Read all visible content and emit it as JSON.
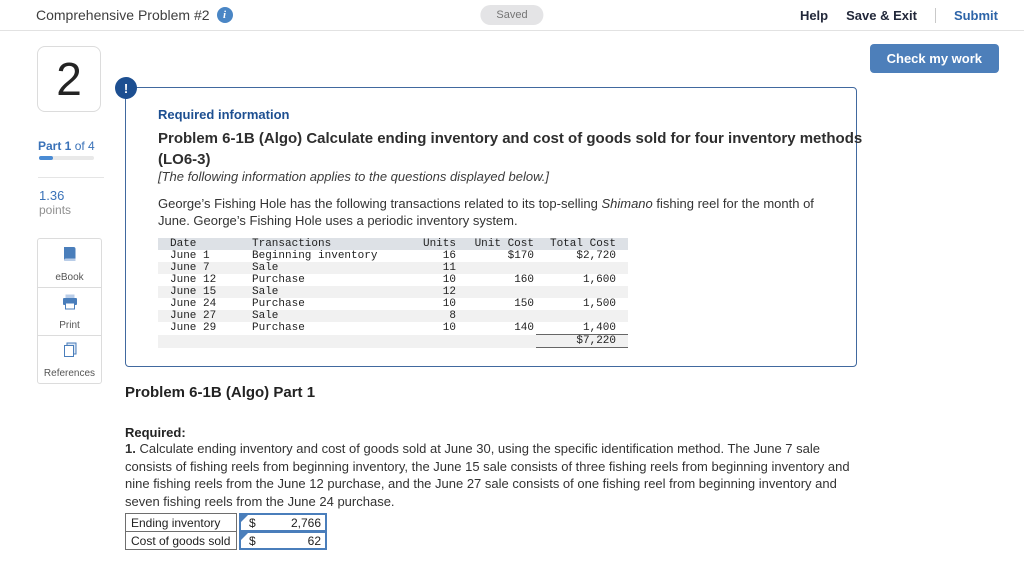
{
  "topbar": {
    "title": "Comprehensive Problem #2",
    "info_icon": "i",
    "saved_badge": "Saved",
    "help": "Help",
    "save_exit": "Save & Exit",
    "submit": "Submit"
  },
  "check_my_work": "Check my work",
  "sidebar": {
    "question_number": "2",
    "part_bold": "Part 1",
    "part_rest": " of 4",
    "progress_percent": 25,
    "points_value": "1.36",
    "points_label": "points",
    "tools": {
      "ebook": "eBook",
      "print": "Print",
      "references": "References"
    }
  },
  "info_box": {
    "alert": "!",
    "required_info": "Required information",
    "title": "Problem 6-1B (Algo) Calculate ending inventory and cost of goods sold for four inventory methods (LO6-3)",
    "subtitle": "[The following information applies to the questions displayed below.]",
    "para_before": "George’s Fishing Hole has the following transactions related to its top-selling ",
    "para_italic": "Shimano",
    "para_after": " fishing reel for the month of June. George’s Fishing Hole uses a periodic inventory system.",
    "table": {
      "headers": {
        "date": "Date",
        "transactions": "Transactions",
        "units": "Units",
        "unit_cost": "Unit Cost",
        "total_cost": "Total Cost"
      },
      "rows": [
        {
          "date": "June 1",
          "trans": "Beginning inventory",
          "units": "16",
          "ucost": "$170",
          "tcost": "$2,720"
        },
        {
          "date": "June 7",
          "trans": "Sale",
          "units": "11",
          "ucost": "",
          "tcost": ""
        },
        {
          "date": "June 12",
          "trans": "Purchase",
          "units": "10",
          "ucost": "160",
          "tcost": "1,600"
        },
        {
          "date": "June 15",
          "trans": "Sale",
          "units": "12",
          "ucost": "",
          "tcost": ""
        },
        {
          "date": "June 24",
          "trans": "Purchase",
          "units": "10",
          "ucost": "150",
          "tcost": "1,500"
        },
        {
          "date": "June 27",
          "trans": "Sale",
          "units": "8",
          "ucost": "",
          "tcost": ""
        },
        {
          "date": "June 29",
          "trans": "Purchase",
          "units": "10",
          "ucost": "140",
          "tcost": "1,400"
        }
      ],
      "total": "$7,220"
    }
  },
  "part_section": {
    "heading": "Problem 6-1B (Algo) Part 1",
    "required_label": "Required:",
    "req_num": "1.",
    "req_text": " Calculate ending inventory and cost of goods sold at June 30, using the specific identification method. The June 7 sale consists of fishing reels from beginning inventory, the June 15 sale consists of three fishing reels from beginning inventory and nine fishing reels from the June 12 purchase, and the June 27 sale consists of one fishing reel from beginning inventory and seven fishing reels from the June 24 purchase."
  },
  "answers": {
    "rows": [
      {
        "label": "Ending inventory",
        "currency": "$",
        "value": "2,766"
      },
      {
        "label": "Cost of goods sold",
        "currency": "$",
        "value": "62"
      }
    ]
  },
  "colors": {
    "accent_blue": "#1d4f91",
    "button_blue": "#4d7fba",
    "input_border_blue": "#4a7ebb",
    "link_blue": "#2d64a8",
    "table_header_bg": "#dde1e6"
  }
}
